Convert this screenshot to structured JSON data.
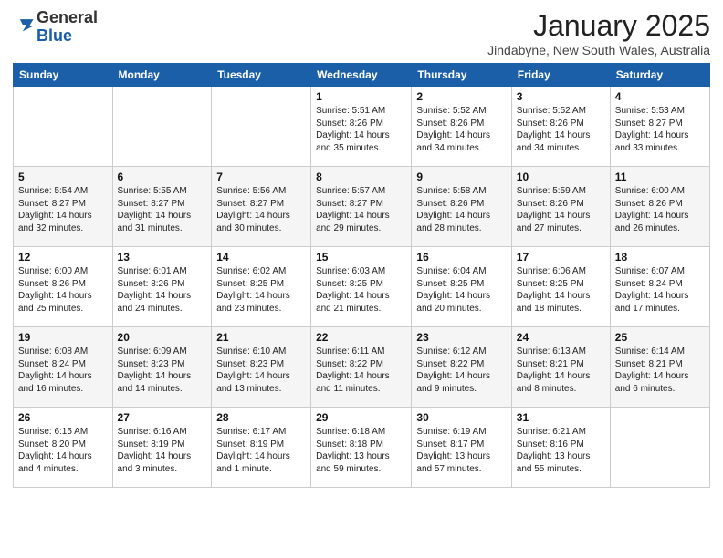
{
  "logo": {
    "general": "General",
    "blue": "Blue"
  },
  "header": {
    "month": "January 2025",
    "location": "Jindabyne, New South Wales, Australia"
  },
  "days_of_week": [
    "Sunday",
    "Monday",
    "Tuesday",
    "Wednesday",
    "Thursday",
    "Friday",
    "Saturday"
  ],
  "weeks": [
    [
      {
        "day": "",
        "info": ""
      },
      {
        "day": "",
        "info": ""
      },
      {
        "day": "",
        "info": ""
      },
      {
        "day": "1",
        "info": "Sunrise: 5:51 AM\nSunset: 8:26 PM\nDaylight: 14 hours\nand 35 minutes."
      },
      {
        "day": "2",
        "info": "Sunrise: 5:52 AM\nSunset: 8:26 PM\nDaylight: 14 hours\nand 34 minutes."
      },
      {
        "day": "3",
        "info": "Sunrise: 5:52 AM\nSunset: 8:26 PM\nDaylight: 14 hours\nand 34 minutes."
      },
      {
        "day": "4",
        "info": "Sunrise: 5:53 AM\nSunset: 8:27 PM\nDaylight: 14 hours\nand 33 minutes."
      }
    ],
    [
      {
        "day": "5",
        "info": "Sunrise: 5:54 AM\nSunset: 8:27 PM\nDaylight: 14 hours\nand 32 minutes."
      },
      {
        "day": "6",
        "info": "Sunrise: 5:55 AM\nSunset: 8:27 PM\nDaylight: 14 hours\nand 31 minutes."
      },
      {
        "day": "7",
        "info": "Sunrise: 5:56 AM\nSunset: 8:27 PM\nDaylight: 14 hours\nand 30 minutes."
      },
      {
        "day": "8",
        "info": "Sunrise: 5:57 AM\nSunset: 8:27 PM\nDaylight: 14 hours\nand 29 minutes."
      },
      {
        "day": "9",
        "info": "Sunrise: 5:58 AM\nSunset: 8:26 PM\nDaylight: 14 hours\nand 28 minutes."
      },
      {
        "day": "10",
        "info": "Sunrise: 5:59 AM\nSunset: 8:26 PM\nDaylight: 14 hours\nand 27 minutes."
      },
      {
        "day": "11",
        "info": "Sunrise: 6:00 AM\nSunset: 8:26 PM\nDaylight: 14 hours\nand 26 minutes."
      }
    ],
    [
      {
        "day": "12",
        "info": "Sunrise: 6:00 AM\nSunset: 8:26 PM\nDaylight: 14 hours\nand 25 minutes."
      },
      {
        "day": "13",
        "info": "Sunrise: 6:01 AM\nSunset: 8:26 PM\nDaylight: 14 hours\nand 24 minutes."
      },
      {
        "day": "14",
        "info": "Sunrise: 6:02 AM\nSunset: 8:25 PM\nDaylight: 14 hours\nand 23 minutes."
      },
      {
        "day": "15",
        "info": "Sunrise: 6:03 AM\nSunset: 8:25 PM\nDaylight: 14 hours\nand 21 minutes."
      },
      {
        "day": "16",
        "info": "Sunrise: 6:04 AM\nSunset: 8:25 PM\nDaylight: 14 hours\nand 20 minutes."
      },
      {
        "day": "17",
        "info": "Sunrise: 6:06 AM\nSunset: 8:25 PM\nDaylight: 14 hours\nand 18 minutes."
      },
      {
        "day": "18",
        "info": "Sunrise: 6:07 AM\nSunset: 8:24 PM\nDaylight: 14 hours\nand 17 minutes."
      }
    ],
    [
      {
        "day": "19",
        "info": "Sunrise: 6:08 AM\nSunset: 8:24 PM\nDaylight: 14 hours\nand 16 minutes."
      },
      {
        "day": "20",
        "info": "Sunrise: 6:09 AM\nSunset: 8:23 PM\nDaylight: 14 hours\nand 14 minutes."
      },
      {
        "day": "21",
        "info": "Sunrise: 6:10 AM\nSunset: 8:23 PM\nDaylight: 14 hours\nand 13 minutes."
      },
      {
        "day": "22",
        "info": "Sunrise: 6:11 AM\nSunset: 8:22 PM\nDaylight: 14 hours\nand 11 minutes."
      },
      {
        "day": "23",
        "info": "Sunrise: 6:12 AM\nSunset: 8:22 PM\nDaylight: 14 hours\nand 9 minutes."
      },
      {
        "day": "24",
        "info": "Sunrise: 6:13 AM\nSunset: 8:21 PM\nDaylight: 14 hours\nand 8 minutes."
      },
      {
        "day": "25",
        "info": "Sunrise: 6:14 AM\nSunset: 8:21 PM\nDaylight: 14 hours\nand 6 minutes."
      }
    ],
    [
      {
        "day": "26",
        "info": "Sunrise: 6:15 AM\nSunset: 8:20 PM\nDaylight: 14 hours\nand 4 minutes."
      },
      {
        "day": "27",
        "info": "Sunrise: 6:16 AM\nSunset: 8:19 PM\nDaylight: 14 hours\nand 3 minutes."
      },
      {
        "day": "28",
        "info": "Sunrise: 6:17 AM\nSunset: 8:19 PM\nDaylight: 14 hours\nand 1 minute."
      },
      {
        "day": "29",
        "info": "Sunrise: 6:18 AM\nSunset: 8:18 PM\nDaylight: 13 hours\nand 59 minutes."
      },
      {
        "day": "30",
        "info": "Sunrise: 6:19 AM\nSunset: 8:17 PM\nDaylight: 13 hours\nand 57 minutes."
      },
      {
        "day": "31",
        "info": "Sunrise: 6:21 AM\nSunset: 8:16 PM\nDaylight: 13 hours\nand 55 minutes."
      },
      {
        "day": "",
        "info": ""
      }
    ]
  ]
}
